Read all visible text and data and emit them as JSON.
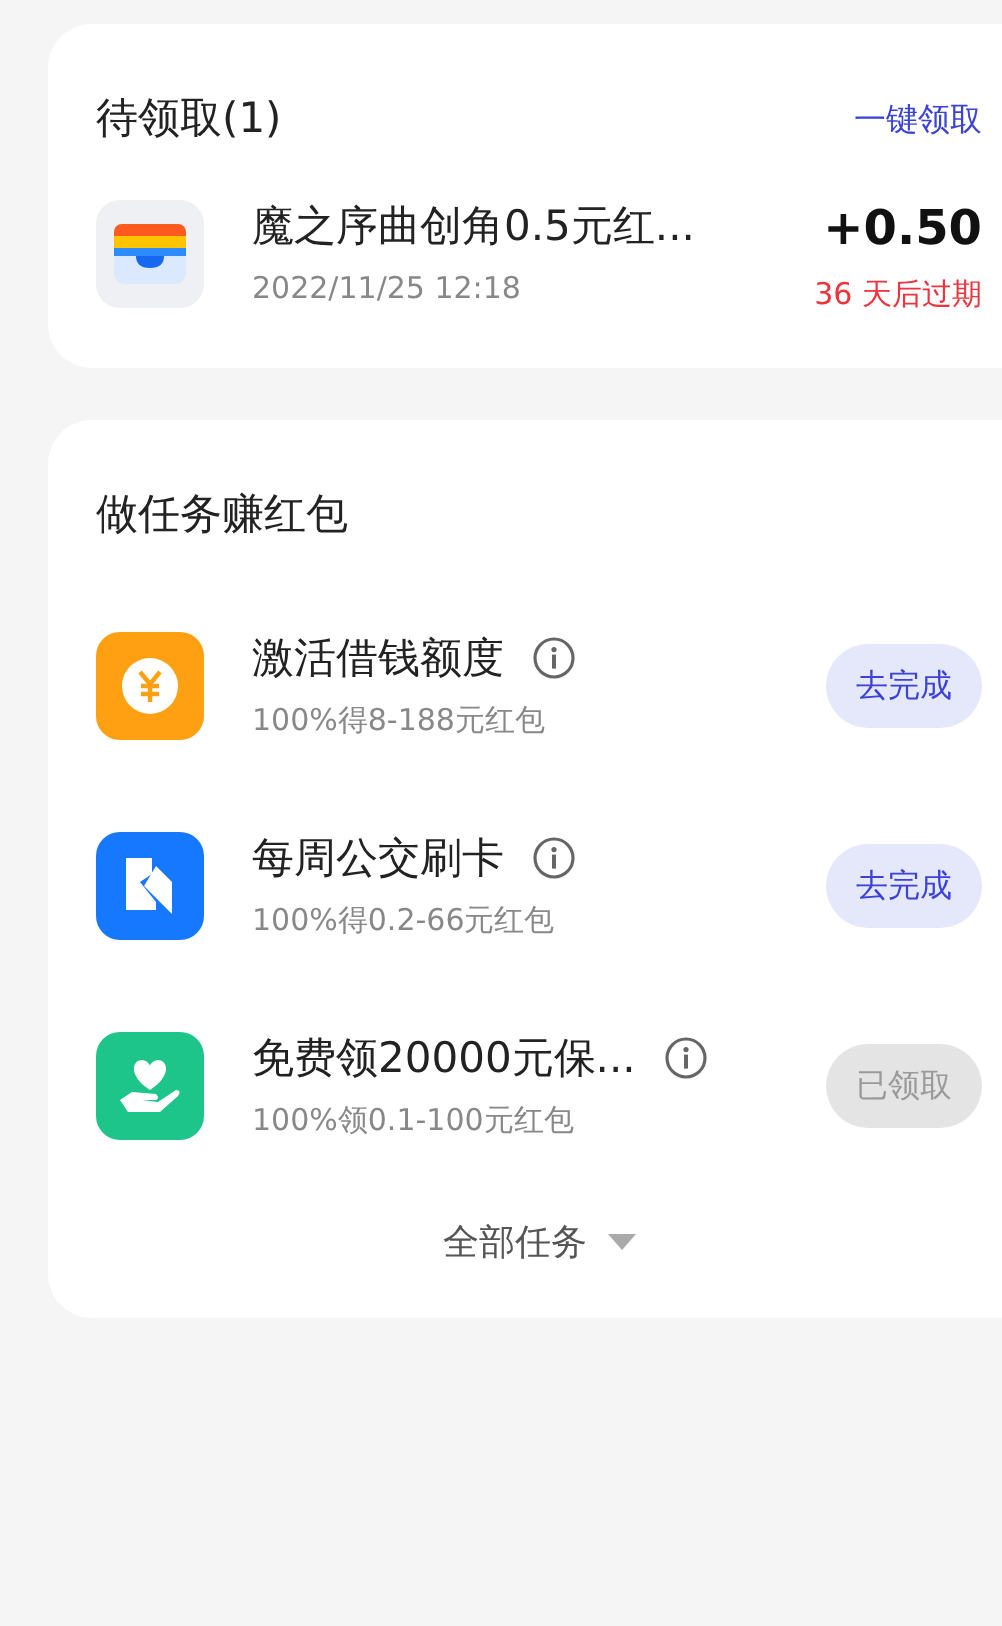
{
  "pending": {
    "title": "待领取(1)",
    "claim_all": "一键领取",
    "items": [
      {
        "kind": "wallet",
        "name": "魔之序曲创角0.5元红...",
        "time": "2022/11/25 12:18",
        "amount": "+0.50",
        "expiry": "36 天后过期"
      }
    ]
  },
  "tasks": {
    "title": "做任务赚红包",
    "items": [
      {
        "kind": "coin",
        "name": "激活借钱额度",
        "reward": "100%得8-188元红包",
        "action": "去完成",
        "disabled": false
      },
      {
        "kind": "card",
        "name": "每周公交刷卡",
        "reward": "100%得0.2-66元红包",
        "action": "去完成",
        "disabled": false
      },
      {
        "kind": "heart",
        "name": "免费领20000元保...",
        "reward": "100%领0.1-100元红包",
        "action": "已领取",
        "disabled": true
      }
    ],
    "more": "全部任务"
  }
}
